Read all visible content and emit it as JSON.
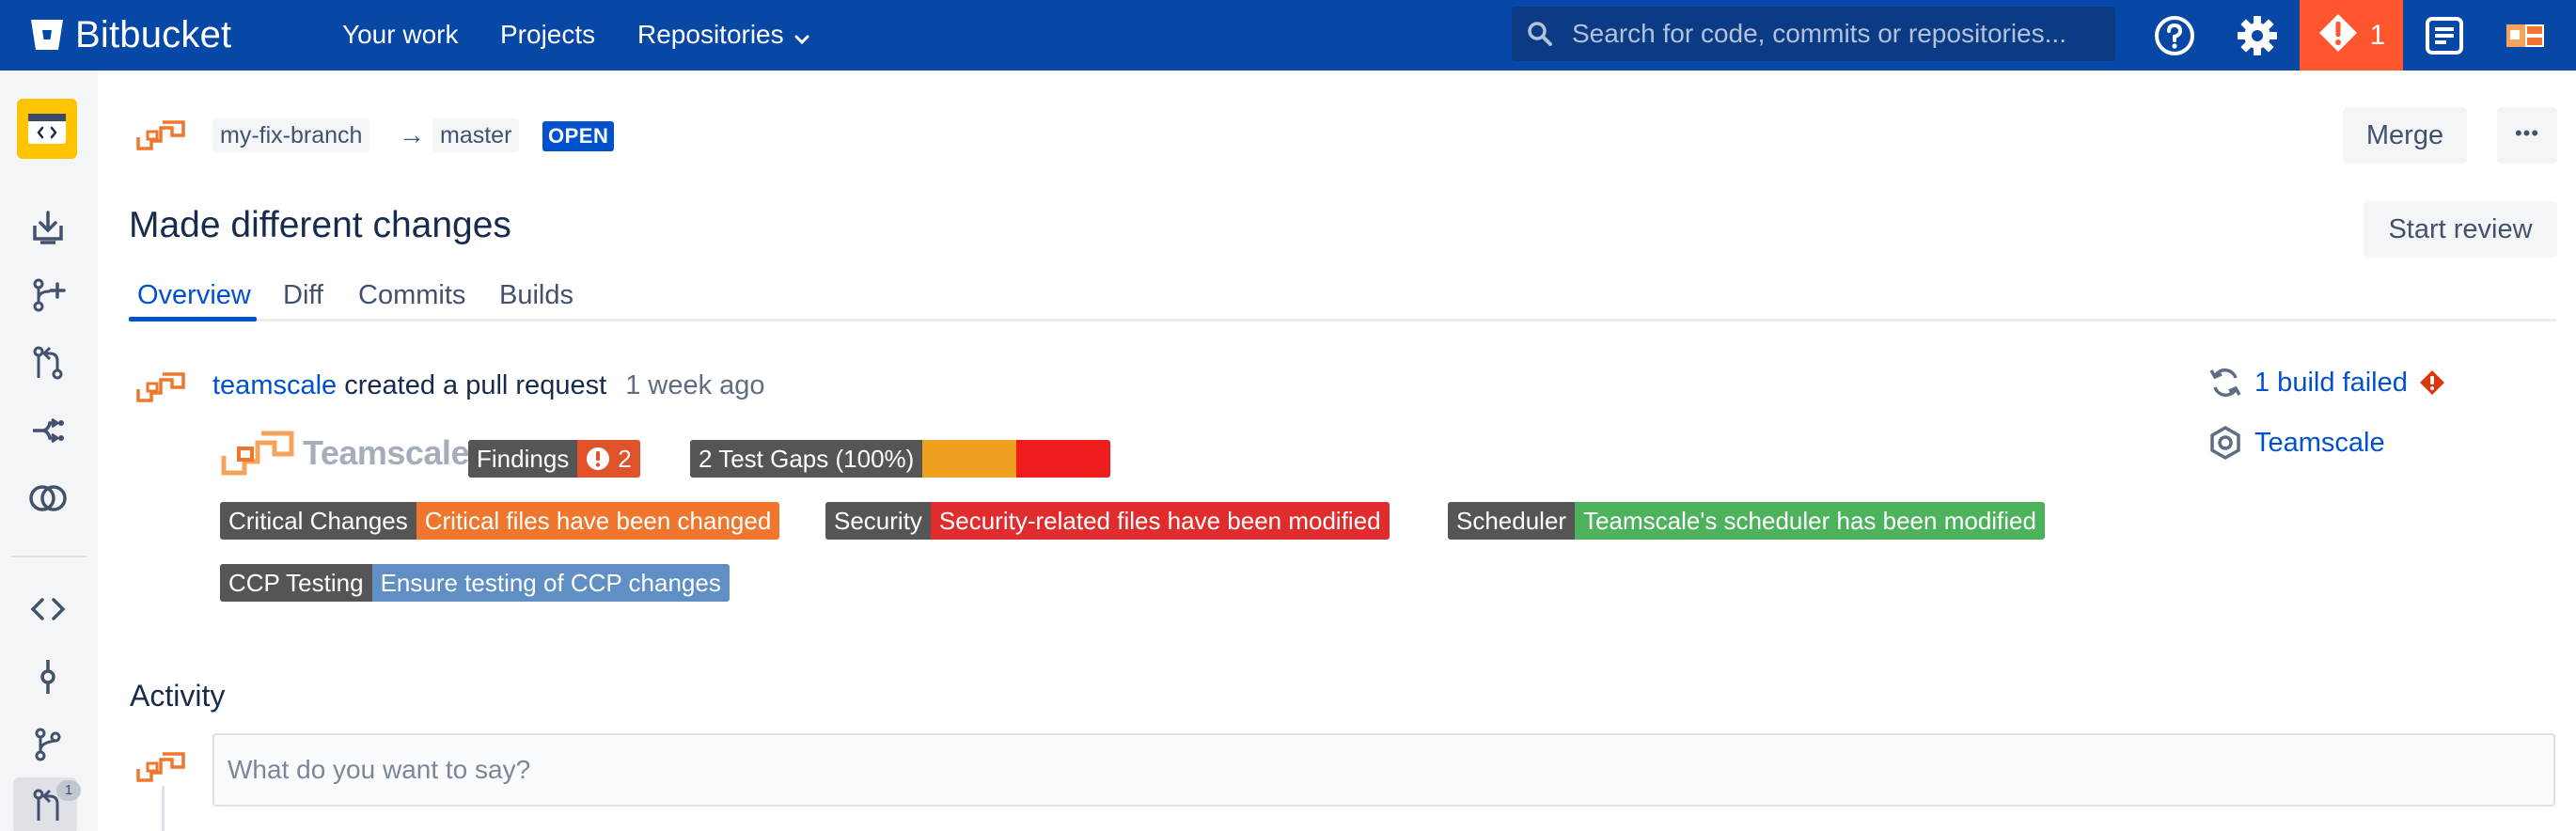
{
  "header": {
    "app_name": "Bitbucket",
    "nav": [
      "Your work",
      "Projects",
      "Repositories"
    ],
    "search_placeholder": "Search for code, commits or repositories...",
    "alert_count": "1",
    "icons": [
      "help-icon",
      "settings-icon",
      "alert-icon",
      "notes-icon",
      "profile-avatar"
    ]
  },
  "sidebar": {
    "icons": [
      "repository-icon",
      "clone-icon",
      "create-branch-icon",
      "compare-icon",
      "fork-icon",
      "compare-branches-icon",
      "source-icon",
      "commits-icon",
      "branches-icon",
      "pull-requests-icon"
    ],
    "pull_requests_badge": "1"
  },
  "pr": {
    "source_branch": "my-fix-branch",
    "target_branch": "master",
    "arrow": "→",
    "status": "OPEN",
    "title": "Made different changes",
    "merge_label": "Merge",
    "more_label": "•••",
    "start_review_label": "Start review",
    "tabs": [
      "Overview",
      "Diff",
      "Commits",
      "Builds"
    ],
    "active_tab": "Overview",
    "author": "teamscale",
    "action": "created a pull request",
    "time": "1 week ago"
  },
  "teamscale": {
    "logo_text": "Teamscale",
    "findings_label": "Findings",
    "findings_count": "2",
    "test_gaps_label": "2 Test Gaps (100%)",
    "test_gap_fraction": 1.0,
    "badges": [
      {
        "key": "Critical Changes",
        "value": "Critical files have been changed",
        "color": "#f0752d"
      },
      {
        "key": "Security",
        "value": "Security-related files have been modified",
        "color": "#e02c2c"
      },
      {
        "key": "Scheduler",
        "value": "Teamscale's scheduler has been modified",
        "color": "#4cb25c"
      },
      {
        "key": "CCP Testing",
        "value": "Ensure testing of CCP changes",
        "color": "#5f8fc5"
      }
    ]
  },
  "builds": {
    "status_label": "1 build failed",
    "tool_label": "Teamscale"
  },
  "activity": {
    "title": "Activity",
    "comment_placeholder": "What do you want to say?"
  },
  "colors": {
    "header_bg": "#0747a6",
    "link": "#0052cc",
    "alert": "#ff5630",
    "badge_dark": "#555555"
  }
}
